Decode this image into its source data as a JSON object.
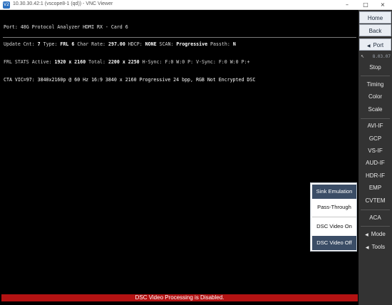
{
  "window": {
    "icon": "V2",
    "title": "10.30.30.42:1 (vscope8-1 (qd)) - VNC Viewer",
    "controls": [
      "–",
      "□",
      "×"
    ]
  },
  "status": {
    "line1": "Port: 48G Protocol Analyzer HDMI RX - Card 6",
    "line2": {
      "update_label": "Update Cnt:",
      "update_value": "7",
      "type_label": "Type:",
      "type_value": "FRL 6",
      "charrate_label": "Char Rate:",
      "charrate_value": "297.00",
      "hdcp_label": "HDCP:",
      "hdcp_value": "NONE",
      "scan_label": "SCAN:",
      "scan_value": "Progressive",
      "passth_label": "Passth:",
      "passth_value": "N"
    },
    "line3": {
      "frl_label": "FRL STATS",
      "active_label": "Active:",
      "active_value": "1920 x 2160",
      "total_label": "Total:",
      "total_value": "2200 x 2250",
      "hsync": "H-Sync: F:0 W:0 P:",
      "vsync": "V-Sync: F:0 W:0 P:+"
    },
    "line4": "CTA VIC=97: 3840x2160p @ 60 Hz 16:9 3840 x 2160 Progressive 24 bpp, RGB Not Encrypted DSC"
  },
  "popup": {
    "sink_emulation": "Sink Emulation",
    "pass_through": "Pass-Through",
    "dsc_on": "DSC Video On",
    "dsc_off": "DSC Video Off"
  },
  "notice": "DSC Video Processing is Disabled.",
  "panel": {
    "home": "Home",
    "back": "Back",
    "port": "Port",
    "port_meta": "8.03.07",
    "stop": "Stop",
    "timing": "Timing",
    "color": "Color",
    "scale": "Scale",
    "avi_if": "AVI-IF",
    "gcp": "GCP",
    "vs_if": "VS-IF",
    "aud_if": "AUD-IF",
    "hdr_if": "HDR-IF",
    "emp": "EMP",
    "cvtem": "CVTEM",
    "aca": "ACA",
    "mode": "Mode",
    "tools": "Tools",
    "arrow_glyph": "◀"
  },
  "colors": {
    "popup_selected": "#3b4d66",
    "notice_bg": "#b31212",
    "panel_bg": "#333333"
  }
}
